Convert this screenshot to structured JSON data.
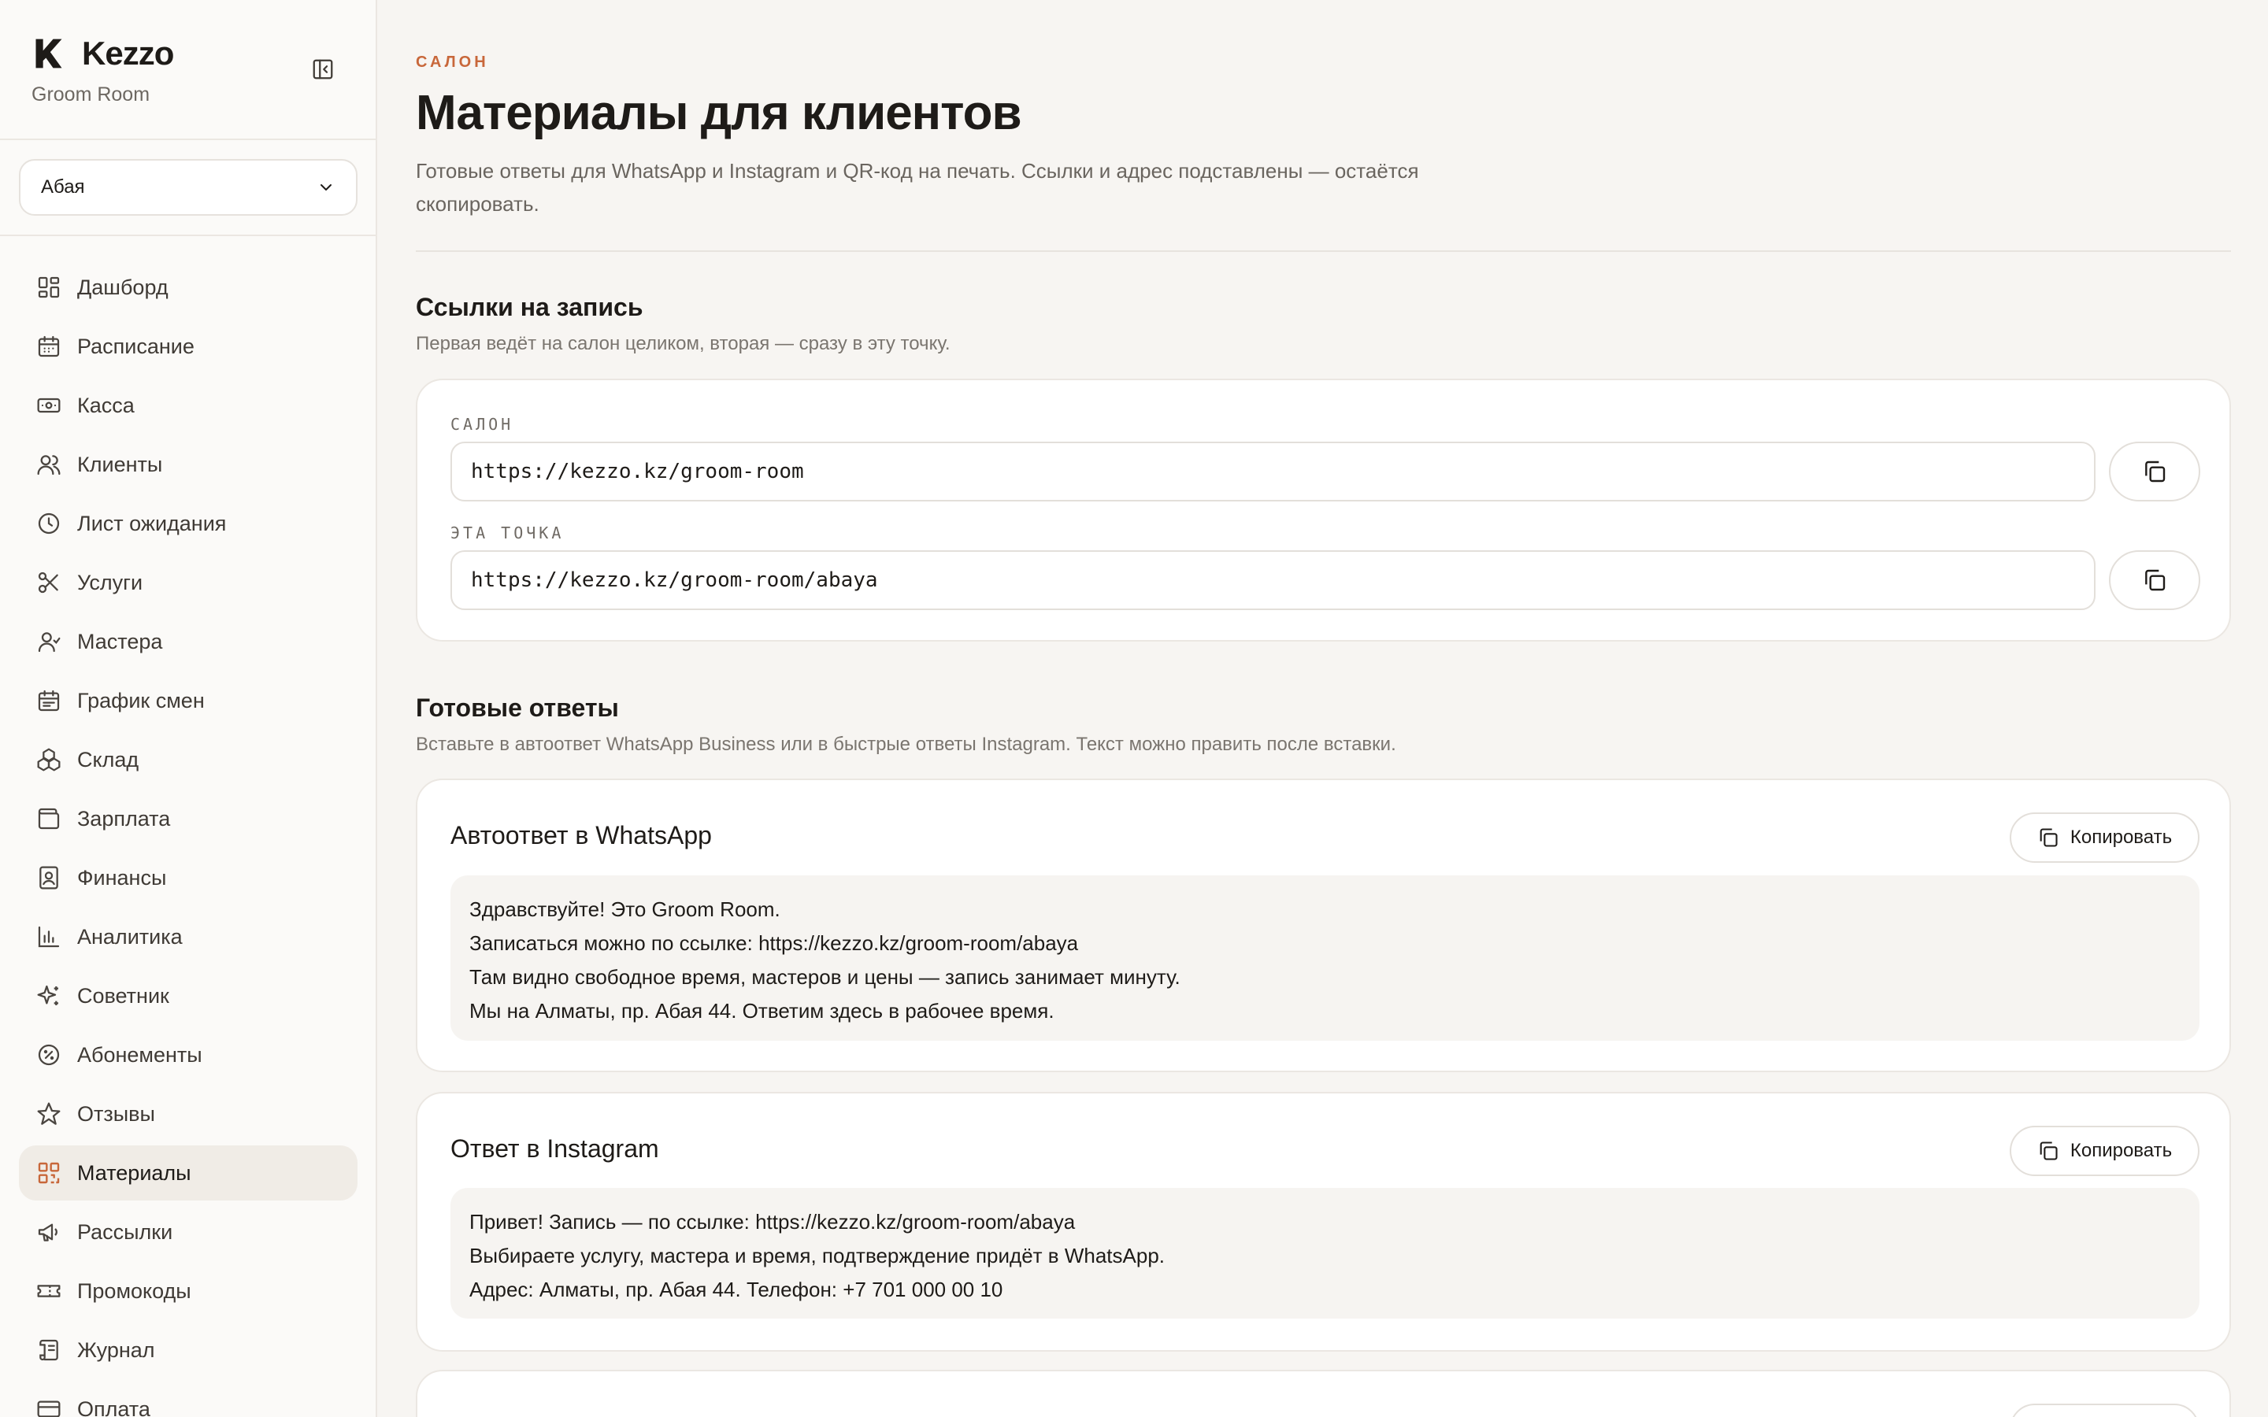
{
  "brand": {
    "name": "Kezzo",
    "subtitle": "Groom Room"
  },
  "branch_select": {
    "value": "Абая"
  },
  "nav": [
    {
      "label": "Дашборд",
      "icon": "dashboard-icon"
    },
    {
      "label": "Расписание",
      "icon": "calendar-icon"
    },
    {
      "label": "Касса",
      "icon": "cash-icon"
    },
    {
      "label": "Клиенты",
      "icon": "users-icon"
    },
    {
      "label": "Лист ожидания",
      "icon": "clock-icon"
    },
    {
      "label": "Услуги",
      "icon": "scissors-icon"
    },
    {
      "label": "Мастера",
      "icon": "masters-icon"
    },
    {
      "label": "График смен",
      "icon": "shift-calendar-icon"
    },
    {
      "label": "Склад",
      "icon": "boxes-icon"
    },
    {
      "label": "Зарплата",
      "icon": "wallet-icon"
    },
    {
      "label": "Финансы",
      "icon": "ledger-icon"
    },
    {
      "label": "Аналитика",
      "icon": "bar-chart-icon"
    },
    {
      "label": "Советник",
      "icon": "sparkles-icon"
    },
    {
      "label": "Абонементы",
      "icon": "badge-percent-icon"
    },
    {
      "label": "Отзывы",
      "icon": "star-icon"
    },
    {
      "label": "Материалы",
      "icon": "qr-code-icon",
      "active": true
    },
    {
      "label": "Рассылки",
      "icon": "megaphone-icon"
    },
    {
      "label": "Промокоды",
      "icon": "ticket-icon"
    },
    {
      "label": "Журнал",
      "icon": "scroll-icon"
    },
    {
      "label": "Оплата",
      "icon": "card-icon"
    }
  ],
  "header": {
    "eyebrow": "САЛОН",
    "title": "Материалы для клиентов",
    "description": "Готовые ответы для WhatsApp и Instagram и QR-код на печать. Ссылки и адрес подставлены — остаётся скопировать."
  },
  "links_section": {
    "title": "Ссылки на запись",
    "description": "Первая ведёт на салон целиком, вторая — сразу в эту точку.",
    "salon_label": "САЛОН",
    "salon_url": "https://kezzo.kz/groom-room",
    "point_label": "ЭТА ТОЧКА",
    "point_url": "https://kezzo.kz/groom-room/abaya"
  },
  "replies_section": {
    "title": "Готовые ответы",
    "description": "Вставьте в автоответ WhatsApp Business или в быстрые ответы Instagram. Текст можно править после вставки.",
    "copy_label": "Копировать",
    "whatsapp": {
      "title": "Автоответ в WhatsApp",
      "lines": [
        "Здравствуйте! Это Groom Room.",
        "Записаться можно по ссылке: https://kezzo.kz/groom-room/abaya",
        "Там видно свободное время, мастеров и цены — запись занимает минуту.",
        "Мы на Алматы, пр. Абая 44. Ответим здесь в рабочее время."
      ]
    },
    "instagram": {
      "title": "Ответ в Instagram",
      "lines": [
        "Привет! Запись — по ссылке: https://kezzo.kz/groom-room/abaya",
        "Выбираете услугу, мастера и время, подтверждение придёт в WhatsApp.",
        "Адрес: Алматы, пр. Абая 44. Телефон: +7 701 000 00 10"
      ]
    }
  },
  "colors": {
    "accent": "#c8673a",
    "background": "#f7f5f2",
    "sidebar": "#fbfaf8",
    "active_nav": "#f0ece6"
  }
}
